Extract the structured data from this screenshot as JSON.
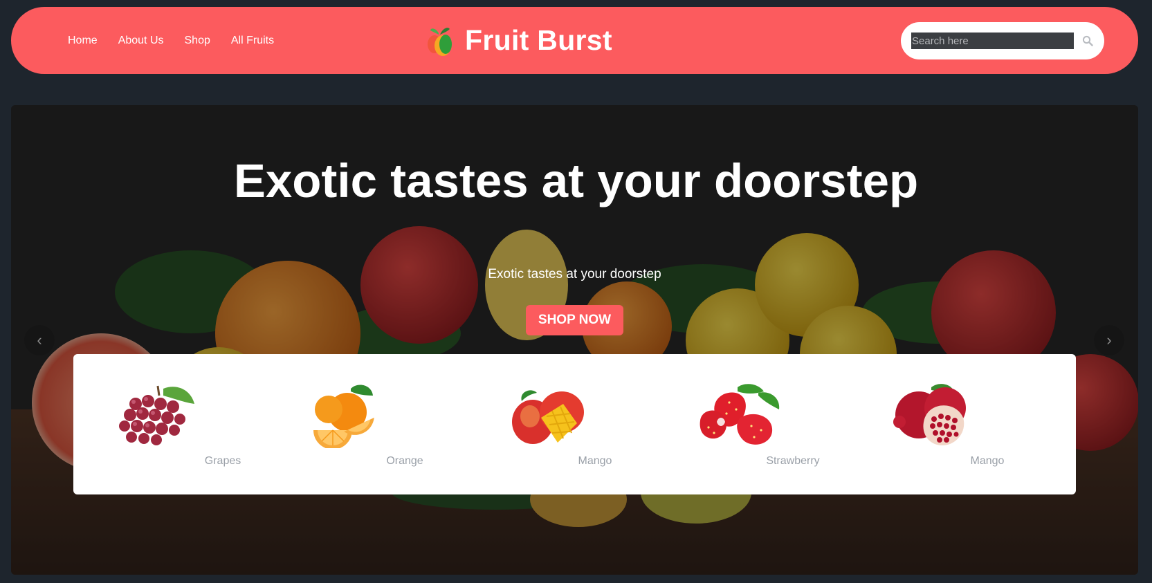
{
  "brand": {
    "name": "Fruit Burst",
    "logo_icon": "fruit-logo-icon"
  },
  "nav": {
    "items": [
      {
        "label": "Home"
      },
      {
        "label": "About Us"
      },
      {
        "label": "Shop"
      },
      {
        "label": "All Fruits"
      }
    ]
  },
  "search": {
    "placeholder": "Search here",
    "value": "",
    "icon": "search-icon"
  },
  "hero": {
    "title": "Exotic tastes at your doorstep",
    "subtitle": "Exotic tastes at your doorstep",
    "cta_label": "SHOP NOW",
    "prev_icon": "‹",
    "next_icon": "›"
  },
  "categories": [
    {
      "label": "Grapes",
      "icon": "grapes-icon"
    },
    {
      "label": "Orange",
      "icon": "orange-icon"
    },
    {
      "label": "Mango",
      "icon": "mango-icon"
    },
    {
      "label": "Strawberry",
      "icon": "strawberry-icon"
    },
    {
      "label": "Mango",
      "icon": "pomegranate-icon"
    }
  ],
  "colors": {
    "accent": "#fc5b5e",
    "page_bg": "#1e252d",
    "card_bg": "#ffffff",
    "muted_text": "#9aa0a8"
  }
}
